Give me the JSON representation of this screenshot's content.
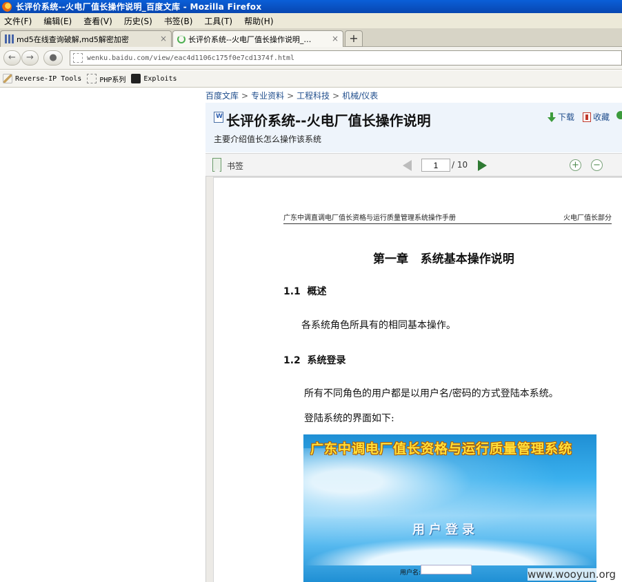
{
  "window": {
    "title": "长评价系统--火电厂值长操作说明_百度文库 - Mozilla Firefox"
  },
  "menu": [
    "文件(F)",
    "编辑(E)",
    "查看(V)",
    "历史(S)",
    "书签(B)",
    "工具(T)",
    "帮助(H)"
  ],
  "tabs": [
    {
      "label": "md5在线查询破解,md5解密加密",
      "active": false
    },
    {
      "label": "长评价系统--火电厂值长操作说明_…",
      "active": true
    }
  ],
  "newtab_label": "+",
  "nav": {
    "back": "←",
    "forward": "→",
    "url": "wenku.baidu.com/view/eac4d1106c175f0e7cd1374f.html"
  },
  "bookmarks": [
    "Reverse-IP Tools",
    "PHP系列",
    "Exploits"
  ],
  "page": {
    "breadcrumb": [
      "百度文库",
      "专业资料",
      "工程科技",
      "机械/仪表"
    ],
    "breadcrumb_sep": ">",
    "doc_title": "长评价系统--火电厂值长操作说明",
    "doc_subtitle": "主要介绍值长怎么操作该系统",
    "download_label": "下载",
    "favorite_label": "收藏"
  },
  "viewer": {
    "bookmark_label": "书签",
    "current_page": "1",
    "total_pages": "/ 10",
    "zoom_in": "+",
    "zoom_out": "−"
  },
  "document": {
    "running_header_left": "广东中调直调电厂值长资格与运行质量管理系统操作手册",
    "running_header_right": "火电厂值长部分",
    "chapter_title": "第一章   系统基本操作说明",
    "section1_heading": "1.1  概述",
    "section1_text": "各系统角色所具有的相同基本操作。",
    "section2_heading": "1.2  系统登录",
    "section2_text1": "所有不同角色的用户都是以用户名/密码的方式登陆本系统。",
    "section2_text2": "登陆系统的界面如下:"
  },
  "login_image": {
    "system_title": "广东中调电厂值长资格与运行质量管理系统",
    "heading": "用户登录",
    "username_label": "用户名:"
  },
  "watermark": "www.wooyun.org",
  "colors": {
    "titlebar": "#0a5fd8",
    "link": "#1f4d8c",
    "next_arrow": "#2f7a33"
  }
}
